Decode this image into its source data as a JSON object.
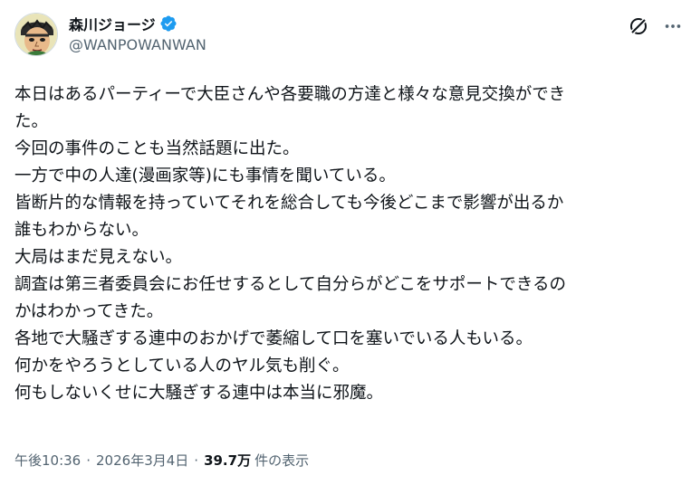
{
  "author": {
    "display_name": "森川ジョージ",
    "handle": "@WANPOWANWAN"
  },
  "icons": {
    "verified": "verified-badge-icon",
    "grok": "grok-icon",
    "more": "more-options-icon",
    "verified_color": "#1d9bf0"
  },
  "tweet": {
    "lines": [
      "本日はあるパーティーで大臣さんや各要職の方達と様々な意見交換ができ",
      "た。",
      "今回の事件のことも当然話題に出た。",
      "一方で中の人達(漫画家等)にも事情を聞いている。",
      "皆断片的な情報を持っていてそれを総合しても今後どこまで影響が出るか",
      "誰もわからない。",
      "大局はまだ見えない。",
      "調査は第三者委員会にお任せするとして自分らがどこをサポートできるの",
      "かはわかってきた。",
      "各地で大騒ぎする連中のおかげで萎縮して口を塞いでいる人もいる。",
      "何かをやろうとしている人のヤル気も削ぐ。",
      "何もしないくせに大騒ぎする連中は本当に邪魔。"
    ]
  },
  "meta": {
    "time": "午後10:36",
    "separator": "·",
    "date": "2026年3月4日",
    "views_count": "39.7万",
    "views_label": "件の表示"
  }
}
